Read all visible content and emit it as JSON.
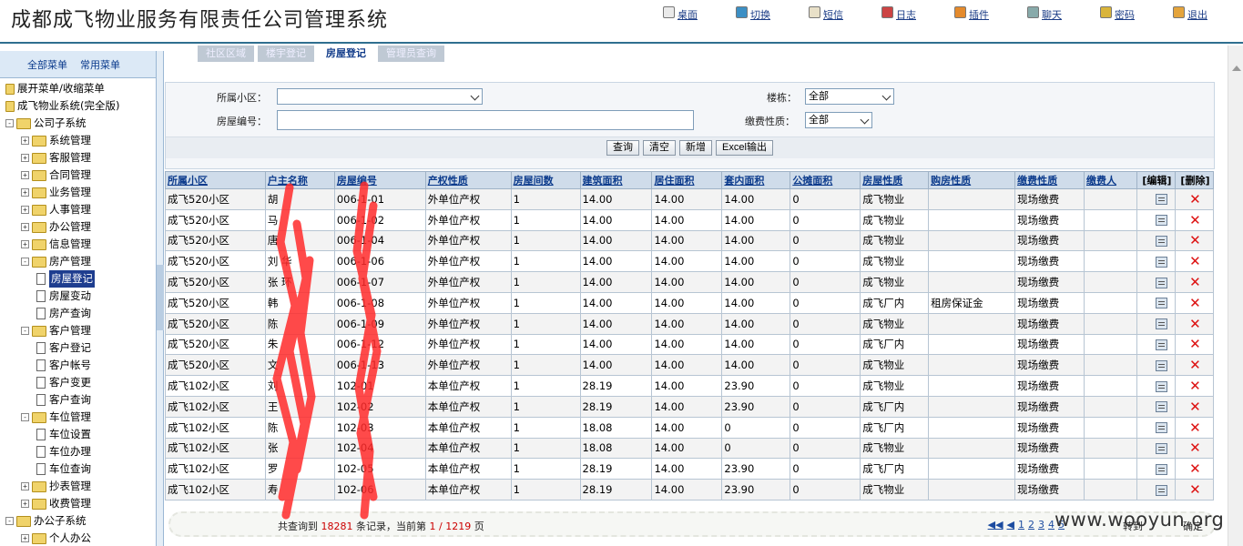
{
  "app": {
    "title": "成都成飞物业服务有限责任公司管理系统"
  },
  "top_nav": [
    {
      "label": "桌面",
      "icon": "desktop-icon"
    },
    {
      "label": "切换",
      "icon": "switch-icon"
    },
    {
      "label": "短信",
      "icon": "sms-icon"
    },
    {
      "label": "日志",
      "icon": "log-icon"
    },
    {
      "label": "插件",
      "icon": "plugin-icon"
    },
    {
      "label": "聊天",
      "icon": "chat-icon"
    },
    {
      "label": "密码",
      "icon": "password-icon"
    },
    {
      "label": "退出",
      "icon": "exit-icon"
    }
  ],
  "sidebar": {
    "tabs": [
      "全部菜单",
      "常用菜单"
    ],
    "tree": [
      {
        "label": "展开菜单/收缩菜单",
        "level": 0,
        "type": "toggle"
      },
      {
        "label": "成飞物业系统(完全版)",
        "level": 0,
        "type": "root"
      },
      {
        "label": "公司子系统",
        "level": 0,
        "type": "folder",
        "exp": "-"
      },
      {
        "label": "系统管理",
        "level": 1,
        "type": "folder",
        "exp": "+"
      },
      {
        "label": "客服管理",
        "level": 1,
        "type": "folder",
        "exp": "+"
      },
      {
        "label": "合同管理",
        "level": 1,
        "type": "folder",
        "exp": "+"
      },
      {
        "label": "业务管理",
        "level": 1,
        "type": "folder",
        "exp": "+"
      },
      {
        "label": "人事管理",
        "level": 1,
        "type": "folder",
        "exp": "+"
      },
      {
        "label": "办公管理",
        "level": 1,
        "type": "folder",
        "exp": "+"
      },
      {
        "label": "信息管理",
        "level": 1,
        "type": "folder",
        "exp": "+"
      },
      {
        "label": "房产管理",
        "level": 1,
        "type": "folder",
        "exp": "-"
      },
      {
        "label": "房屋登记",
        "level": 2,
        "type": "leaf",
        "selected": true
      },
      {
        "label": "房屋变动",
        "level": 2,
        "type": "leaf"
      },
      {
        "label": "房产查询",
        "level": 2,
        "type": "leaf"
      },
      {
        "label": "客户管理",
        "level": 1,
        "type": "folder",
        "exp": "-"
      },
      {
        "label": "客户登记",
        "level": 2,
        "type": "leaf"
      },
      {
        "label": "客户帐号",
        "level": 2,
        "type": "leaf"
      },
      {
        "label": "客户变更",
        "level": 2,
        "type": "leaf"
      },
      {
        "label": "客户查询",
        "level": 2,
        "type": "leaf"
      },
      {
        "label": "车位管理",
        "level": 1,
        "type": "folder",
        "exp": "-"
      },
      {
        "label": "车位设置",
        "level": 2,
        "type": "leaf"
      },
      {
        "label": "车位办理",
        "level": 2,
        "type": "leaf"
      },
      {
        "label": "车位查询",
        "level": 2,
        "type": "leaf"
      },
      {
        "label": "抄表管理",
        "level": 1,
        "type": "folder",
        "exp": "+"
      },
      {
        "label": "收费管理",
        "level": 1,
        "type": "folder",
        "exp": "+"
      },
      {
        "label": "办公子系统",
        "level": 0,
        "type": "folder",
        "exp": "-"
      },
      {
        "label": "个人办公",
        "level": 1,
        "type": "folder",
        "exp": "+"
      }
    ]
  },
  "page_tabs": [
    {
      "label": "社区区域",
      "active": false
    },
    {
      "label": "楼宇登记",
      "active": false
    },
    {
      "label": "房屋登记",
      "active": true
    },
    {
      "label": "管理员查询",
      "active": false
    }
  ],
  "search": {
    "community_label": "所属小区：",
    "community_value": "",
    "building_label": "楼栋：",
    "building_value": "全部",
    "house_no_label": "房屋编号：",
    "house_no_value": "",
    "fee_type_label": "缴费性质：",
    "fee_type_value": "全部",
    "buttons": [
      "查询",
      "清空",
      "新增",
      "Excel输出"
    ]
  },
  "table": {
    "columns": [
      "所属小区",
      "户主名称",
      "房屋编号",
      "产权性质",
      "房屋间数",
      "建筑面积",
      "居住面积",
      "套内面积",
      "公摊面积",
      "房屋性质",
      "购房性质",
      "缴费性质",
      "缴费人",
      "[编辑]",
      "[删除]"
    ],
    "rows": [
      [
        "成飞520小区",
        "胡",
        "006-1-01",
        "外单位产权",
        "1",
        "14.00",
        "14.00",
        "14.00",
        "0",
        "成飞物业",
        "",
        "现场缴费",
        ""
      ],
      [
        "成飞520小区",
        "马",
        "006-1-02",
        "外单位产权",
        "1",
        "14.00",
        "14.00",
        "14.00",
        "0",
        "成飞物业",
        "",
        "现场缴费",
        ""
      ],
      [
        "成飞520小区",
        "唐",
        "006-1-04",
        "外单位产权",
        "1",
        "14.00",
        "14.00",
        "14.00",
        "0",
        "成飞物业",
        "",
        "现场缴费",
        ""
      ],
      [
        "成飞520小区",
        "刘 华",
        "006-1-06",
        "外单位产权",
        "1",
        "14.00",
        "14.00",
        "14.00",
        "0",
        "成飞物业",
        "",
        "现场缴费",
        ""
      ],
      [
        "成飞520小区",
        "张 环",
        "006-1-07",
        "外单位产权",
        "1",
        "14.00",
        "14.00",
        "14.00",
        "0",
        "成飞物业",
        "",
        "现场缴费",
        ""
      ],
      [
        "成飞520小区",
        "韩",
        "006-1-08",
        "外单位产权",
        "1",
        "14.00",
        "14.00",
        "14.00",
        "0",
        "成飞厂内",
        "租房保证金",
        "现场缴费",
        ""
      ],
      [
        "成飞520小区",
        "陈",
        "006-1-09",
        "外单位产权",
        "1",
        "14.00",
        "14.00",
        "14.00",
        "0",
        "成飞物业",
        "",
        "现场缴费",
        ""
      ],
      [
        "成飞520小区",
        "朱",
        "006-1-12",
        "外单位产权",
        "1",
        "14.00",
        "14.00",
        "14.00",
        "0",
        "成飞厂内",
        "",
        "现场缴费",
        ""
      ],
      [
        "成飞520小区",
        "文",
        "006-1-13",
        "外单位产权",
        "1",
        "14.00",
        "14.00",
        "14.00",
        "0",
        "成飞物业",
        "",
        "现场缴费",
        ""
      ],
      [
        "成飞102小区",
        "刘",
        "102-01",
        "本单位产权",
        "1",
        "28.19",
        "14.00",
        "23.90",
        "0",
        "成飞物业",
        "",
        "现场缴费",
        ""
      ],
      [
        "成飞102小区",
        "王",
        "102-02",
        "本单位产权",
        "1",
        "28.19",
        "14.00",
        "23.90",
        "0",
        "成飞厂内",
        "",
        "现场缴费",
        ""
      ],
      [
        "成飞102小区",
        "陈",
        "102-03",
        "本单位产权",
        "1",
        "18.08",
        "14.00",
        "0",
        "0",
        "成飞厂内",
        "",
        "现场缴费",
        ""
      ],
      [
        "成飞102小区",
        "张",
        "102-04",
        "本单位产权",
        "1",
        "18.08",
        "14.00",
        "0",
        "0",
        "成飞物业",
        "",
        "现场缴费",
        ""
      ],
      [
        "成飞102小区",
        "罗",
        "102-05",
        "本单位产权",
        "1",
        "28.19",
        "14.00",
        "23.90",
        "0",
        "成飞厂内",
        "",
        "现场缴费",
        ""
      ],
      [
        "成飞102小区",
        "寿",
        "102-06",
        "本单位产权",
        "1",
        "28.19",
        "14.00",
        "23.90",
        "0",
        "成飞物业",
        "",
        "现场缴费",
        ""
      ]
    ]
  },
  "pager": {
    "prefix": "共查询到",
    "total": "18281",
    "middle": "条记录，当前第",
    "current": "1",
    "sep": "/",
    "pages": "1219",
    "suffix": "页",
    "links": [
      "◀◀",
      "◀",
      "1",
      "2",
      "3",
      "4",
      "5"
    ],
    "goto_label": "转到",
    "goto_button": "确定"
  },
  "watermark": "www.wooyun.org",
  "colors": {
    "header_line": "#2f6f8f",
    "link": "#1b3c86",
    "delete": "#dd1111",
    "scribble": "#ff2a2a"
  }
}
